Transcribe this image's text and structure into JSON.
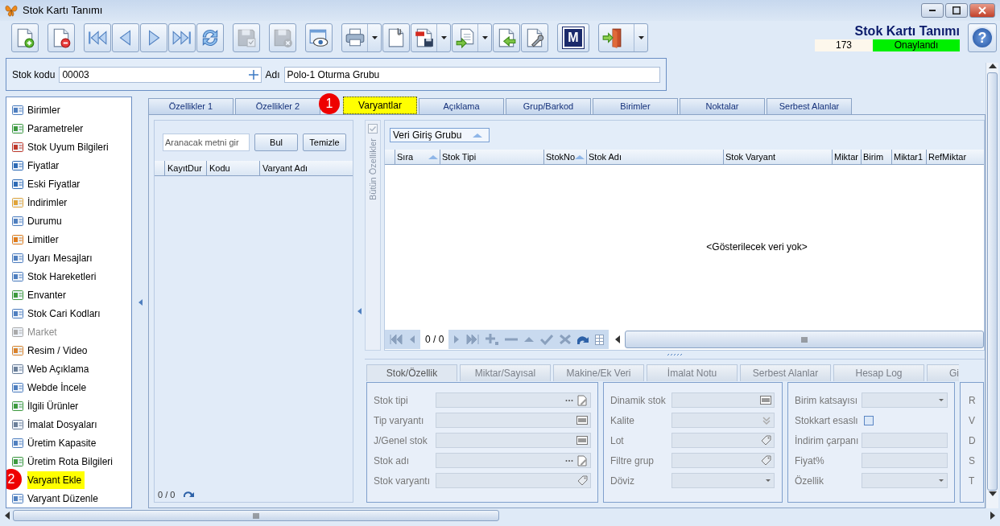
{
  "window": {
    "title": "Stok Kartı Tanımı"
  },
  "toolbar": [
    {
      "kind": "new",
      "disabled": false,
      "menu": false
    },
    {
      "kind": "separator"
    },
    {
      "kind": "delete",
      "disabled": false,
      "menu": false
    },
    {
      "kind": "separator"
    },
    {
      "kind": "first",
      "disabled": false,
      "menu": false
    },
    {
      "kind": "prev",
      "disabled": false,
      "menu": false
    },
    {
      "kind": "next",
      "disabled": false,
      "menu": false
    },
    {
      "kind": "last",
      "disabled": false,
      "menu": false
    },
    {
      "kind": "refresh",
      "disabled": false,
      "menu": false
    },
    {
      "kind": "separator"
    },
    {
      "kind": "save",
      "disabled": true,
      "menu": false
    },
    {
      "kind": "separator"
    },
    {
      "kind": "discard",
      "disabled": true,
      "menu": false
    },
    {
      "kind": "separator"
    },
    {
      "kind": "preview",
      "disabled": false,
      "menu": false
    },
    {
      "kind": "separator"
    },
    {
      "kind": "print",
      "disabled": false,
      "menu": true
    },
    {
      "kind": "attach",
      "disabled": false,
      "menu": false
    },
    {
      "kind": "pdf",
      "disabled": false,
      "menu": true
    },
    {
      "kind": "export",
      "disabled": false,
      "menu": true
    },
    {
      "kind": "import",
      "disabled": false,
      "menu": false
    },
    {
      "kind": "settings",
      "disabled": false,
      "menu": false
    },
    {
      "kind": "separator"
    },
    {
      "kind": "module",
      "label": "M",
      "disabled": false,
      "menu": false
    },
    {
      "kind": "separator"
    },
    {
      "kind": "exit",
      "disabled": false,
      "menu": true
    }
  ],
  "header": {
    "title": "Stok Kartı Tanımı",
    "record_no": "173",
    "status": "Onaylandı",
    "help": "?"
  },
  "stock_code": {
    "label": "Stok kodu",
    "value": "00003"
  },
  "stock_name": {
    "label": "Adı",
    "value": "Polo-1 Oturma Grubu"
  },
  "sidebar": {
    "items": [
      {
        "label": "Birimler",
        "disabled": false,
        "highlighted": false
      },
      {
        "label": "Parametreler",
        "disabled": false,
        "highlighted": false
      },
      {
        "label": "Stok Uyum Bilgileri",
        "disabled": false,
        "highlighted": false
      },
      {
        "label": "Fiyatlar",
        "disabled": false,
        "highlighted": false
      },
      {
        "label": "Eski Fiyatlar",
        "disabled": false,
        "highlighted": false
      },
      {
        "label": "İndirimler",
        "disabled": false,
        "highlighted": false
      },
      {
        "label": "Durumu",
        "disabled": false,
        "highlighted": false
      },
      {
        "label": "Limitler",
        "disabled": false,
        "highlighted": false
      },
      {
        "label": "Uyarı Mesajları",
        "disabled": false,
        "highlighted": false
      },
      {
        "label": "Stok Hareketleri",
        "disabled": false,
        "highlighted": false
      },
      {
        "label": "Envanter",
        "disabled": false,
        "highlighted": false
      },
      {
        "label": "Stok Cari Kodları",
        "disabled": false,
        "highlighted": false
      },
      {
        "label": "Market",
        "disabled": true,
        "highlighted": false
      },
      {
        "label": "Resim / Video",
        "disabled": false,
        "highlighted": false
      },
      {
        "label": "Web Açıklama",
        "disabled": false,
        "highlighted": false
      },
      {
        "label": "Webde İncele",
        "disabled": false,
        "highlighted": false
      },
      {
        "label": "İlgili Ürünler",
        "disabled": false,
        "highlighted": false
      },
      {
        "label": "İmalat Dosyaları",
        "disabled": false,
        "highlighted": false
      },
      {
        "label": "Üretim Kapasite",
        "disabled": false,
        "highlighted": false
      },
      {
        "label": "Üretim Rota Bilgileri",
        "disabled": false,
        "highlighted": false
      },
      {
        "label": "Varyant Ekle",
        "disabled": false,
        "highlighted": true,
        "marker": "2"
      },
      {
        "label": "Varyant Düzenle",
        "disabled": false,
        "highlighted": false
      }
    ]
  },
  "tabs": [
    {
      "label": "Özellikler 1",
      "selected": false
    },
    {
      "label": "Özellikler 2",
      "selected": false
    },
    {
      "label": "Varyantlar",
      "selected": true,
      "marker": "1"
    },
    {
      "label": "Açıklama",
      "selected": false
    },
    {
      "label": "Grup/Barkod",
      "selected": false
    },
    {
      "label": "Birimler",
      "selected": false
    },
    {
      "label": "Noktalar",
      "selected": false
    },
    {
      "label": "Serbest Alanlar",
      "selected": false
    }
  ],
  "variant_list": {
    "search_placeholder": "Aranacak metni gir",
    "find_button": "Bul",
    "clear_button": "Temizle",
    "columns": [
      "KayıtDur",
      "Kodu",
      "Varyant Adı"
    ],
    "counter": "0 / 0"
  },
  "side_strip": {
    "label": "Bütün Özellikler",
    "checked": true
  },
  "grid": {
    "group_by": "Veri Giriş Grubu",
    "columns": [
      {
        "label": "Sıra",
        "sorted": true
      },
      {
        "label": "Stok Tipi",
        "sorted": false
      },
      {
        "label": "StokNo",
        "sorted": true
      },
      {
        "label": "Stok Adı",
        "sorted": false
      },
      {
        "label": "Stok Varyant",
        "sorted": false
      },
      {
        "label": "Miktar",
        "sorted": false
      },
      {
        "label": "Birim",
        "sorted": false
      },
      {
        "label": "Miktar1",
        "sorted": false
      },
      {
        "label": "RefMiktar",
        "sorted": false
      }
    ],
    "empty_text": "<Gösterilecek veri yok>",
    "counter": "0 / 0"
  },
  "detail_tabs": [
    {
      "label": "Stok/Özellik",
      "selected": true
    },
    {
      "label": "Miktar/Sayısal",
      "selected": false
    },
    {
      "label": "Makine/Ek Veri",
      "selected": false
    },
    {
      "label": "İmalat Notu",
      "selected": false
    },
    {
      "label": "Serbest Alanlar",
      "selected": false
    },
    {
      "label": "Hesap Log",
      "selected": false
    },
    {
      "label": "Gi",
      "selected": false
    }
  ],
  "field_groups": [
    {
      "fields": [
        {
          "label": "Stok tipi",
          "kind": "lookup"
        },
        {
          "label": "Tip varyantı",
          "kind": "barcode"
        },
        {
          "label": "J/Genel stok",
          "kind": "barcode"
        },
        {
          "label": "Stok adı",
          "kind": "lookup"
        },
        {
          "label": "Stok varyantı",
          "kind": "tag"
        }
      ]
    },
    {
      "fields": [
        {
          "label": "Dinamik stok",
          "kind": "barcode"
        },
        {
          "label": "Kalite",
          "kind": "chevron"
        },
        {
          "label": "Lot",
          "kind": "tag"
        },
        {
          "label": "Filtre grup",
          "kind": "tag"
        },
        {
          "label": "Döviz",
          "kind": "combo"
        }
      ]
    },
    {
      "fields": [
        {
          "label": "Birim katsayısı",
          "kind": "combo"
        },
        {
          "label": "Stokkart esaslı",
          "kind": "checkbox",
          "checked": false
        },
        {
          "label": "İndirim çarpanı",
          "kind": "plain"
        },
        {
          "label": "Fiyat%",
          "kind": "plain"
        },
        {
          "label": "Özellik",
          "kind": "combo"
        }
      ]
    },
    {
      "fields": [
        {
          "label": "R",
          "kind": "cut"
        },
        {
          "label": "V",
          "kind": "cut"
        },
        {
          "label": "D",
          "kind": "cut"
        },
        {
          "label": "S",
          "kind": "cut"
        },
        {
          "label": "T",
          "kind": "cut"
        }
      ]
    }
  ]
}
